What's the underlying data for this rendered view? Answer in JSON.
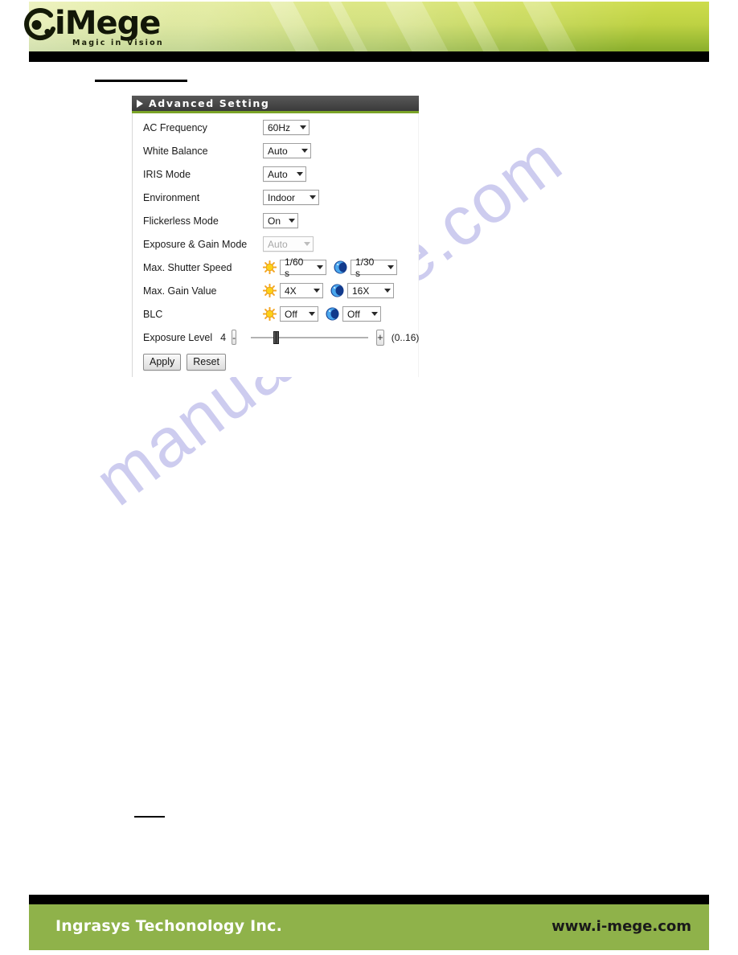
{
  "banner": {
    "logo_word": "iMege",
    "logo_tagline": "Magic in Vision",
    "logo_mark_icon": "imege-swirl-logo-icon"
  },
  "panel": {
    "title": "Advanced Setting",
    "expander_icon": "triangle-right-icon",
    "rows": [
      {
        "label": "AC Frequency",
        "control": "select",
        "value": "60Hz"
      },
      {
        "label": "White Balance",
        "control": "select",
        "value": "Auto"
      },
      {
        "label": "IRIS Mode",
        "control": "select",
        "value": "Auto"
      },
      {
        "label": "Environment",
        "control": "select",
        "value": "Indoor"
      },
      {
        "label": "Flickerless Mode",
        "control": "select",
        "value": "On"
      },
      {
        "label": "Exposure & Gain Mode",
        "control": "select-disabled",
        "value": "Auto"
      }
    ],
    "day_night_rows": [
      {
        "label": "Max. Shutter Speed",
        "day_value": "1/60 s",
        "night_value": "1/30 s"
      },
      {
        "label": "Max. Gain Value",
        "day_value": "4X",
        "night_value": "16X"
      },
      {
        "label": "BLC",
        "day_value": "Off",
        "night_value": "Off"
      }
    ],
    "day_icon": "sun-icon",
    "night_icon": "moon-icon",
    "exposure": {
      "label": "Exposure Level",
      "value": "4",
      "decrement_label": "-",
      "increment_label": "+",
      "range_hint": "(0..16)",
      "slider_percent": 20
    },
    "buttons": {
      "apply": "Apply",
      "reset": "Reset"
    }
  },
  "footer": {
    "company": "Ingrasys Techonology Inc.",
    "website": "www.i-mege.com"
  },
  "watermark": {
    "text": "manualshive.com"
  },
  "colors": {
    "banner_green_light": "#cddc4c",
    "banner_green_dark": "#78a022",
    "panel_header_accent": "#7ba428",
    "footer_green": "#8fb24a",
    "watermark": "#c9c8ee"
  }
}
